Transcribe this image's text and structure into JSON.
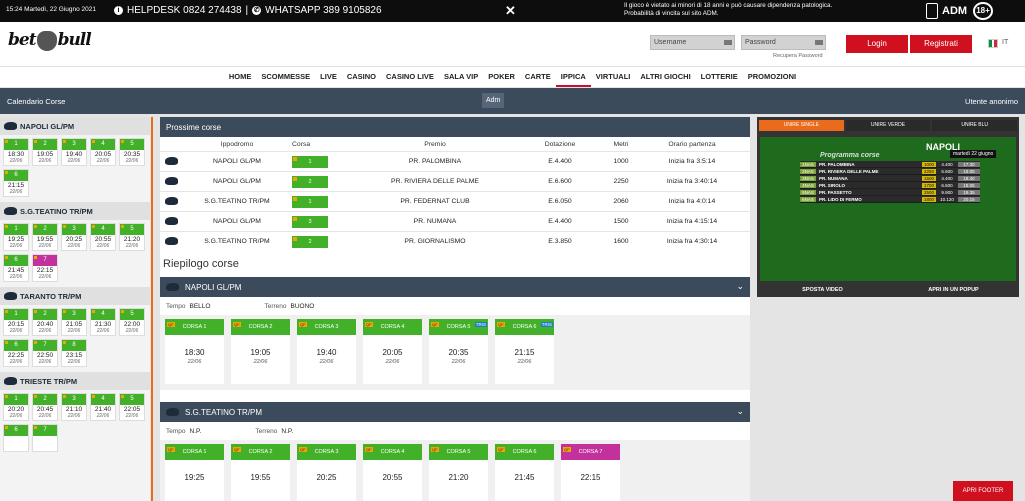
{
  "topbar": {
    "datetime": "15:24 Martedì, 22 Giugno 2021",
    "helpdesk": "HELPDESK 0824 274438",
    "whatsapp": "WHATSAPP 389 9105826",
    "close": "✕",
    "warning1": "Il gioco è vietato ai minori di 18 anni e può causare dipendenza patologica.",
    "warning2": "Probabilità di vincita sul sito ADM.",
    "adm": "ADM",
    "age": "18+"
  },
  "header": {
    "logo_a": "bet",
    "logo_b": "bull",
    "username_placeholder": "Username",
    "password_placeholder": "Password",
    "recover": "Recupera Password",
    "login": "Login",
    "register": "Registrati",
    "lang": "IT"
  },
  "nav": [
    "HOME",
    "SCOMMESSE",
    "LIVE",
    "CASINO",
    "CASINO LIVE",
    "SALA VIP",
    "POKER",
    "CARTE",
    "IPPICA",
    "VIRTUALI",
    "ALTRI GIOCHI",
    "LOTTERIE",
    "PROMOZIONI"
  ],
  "subbar": {
    "left": "Calendario Corse",
    "mid": "Adm",
    "right": "Utente anonimo"
  },
  "sidebar": [
    {
      "name": "NAPOLI GL/PM",
      "cells": [
        {
          "n": "1",
          "t": "18:30",
          "d": "22/06"
        },
        {
          "n": "2",
          "t": "19:05",
          "d": "22/06"
        },
        {
          "n": "3",
          "t": "19:40",
          "d": "22/06"
        },
        {
          "n": "4",
          "t": "20:05",
          "d": "22/06"
        },
        {
          "n": "5",
          "t": "20:35",
          "d": "22/06"
        },
        {
          "n": "6",
          "t": "21:15",
          "d": "22/06"
        }
      ]
    },
    {
      "name": "S.G.TEATINO TR/PM",
      "cells": [
        {
          "n": "1",
          "t": "19:25",
          "d": "22/06"
        },
        {
          "n": "2",
          "t": "19:55",
          "d": "22/06"
        },
        {
          "n": "3",
          "t": "20:25",
          "d": "22/06"
        },
        {
          "n": "4",
          "t": "20:55",
          "d": "22/06"
        },
        {
          "n": "5",
          "t": "21:20",
          "d": "22/06"
        },
        {
          "n": "6",
          "t": "21:45",
          "d": "22/06"
        },
        {
          "n": "7",
          "t": "22:15",
          "d": "22/06",
          "pink": true
        }
      ]
    },
    {
      "name": "TARANTO TR/PM",
      "cells": [
        {
          "n": "1",
          "t": "20:15",
          "d": "22/06"
        },
        {
          "n": "2",
          "t": "20:40",
          "d": "22/06"
        },
        {
          "n": "3",
          "t": "21:05",
          "d": "22/06"
        },
        {
          "n": "4",
          "t": "21:30",
          "d": "22/06"
        },
        {
          "n": "5",
          "t": "22:00",
          "d": "22/06"
        },
        {
          "n": "6",
          "t": "22:25",
          "d": "22/06"
        },
        {
          "n": "7",
          "t": "22:50",
          "d": "22/06"
        },
        {
          "n": "8",
          "t": "23:15",
          "d": "22/06"
        }
      ]
    },
    {
      "name": "TRIESTE TR/PM",
      "cells": [
        {
          "n": "1",
          "t": "20:20",
          "d": "22/06"
        },
        {
          "n": "2",
          "t": "20:45",
          "d": "22/06"
        },
        {
          "n": "3",
          "t": "21:10",
          "d": "22/06"
        },
        {
          "n": "4",
          "t": "21:40",
          "d": "22/06"
        },
        {
          "n": "5",
          "t": "22:05",
          "d": "22/06"
        },
        {
          "n": "6",
          "t": "",
          "d": ""
        },
        {
          "n": "7",
          "t": "",
          "d": ""
        }
      ]
    }
  ],
  "prossime": {
    "title": "Prossime corse",
    "headers": [
      "Ippodromo",
      "Corsa",
      "Premio",
      "Dotazione",
      "Metri",
      "Orario partenza"
    ],
    "rows": [
      [
        "NAPOLI GL/PM",
        "1",
        "PR. PALOMBINA",
        "E.4.400",
        "1000",
        "Inizia fra 3:5:14"
      ],
      [
        "NAPOLI GL/PM",
        "2",
        "PR. RIVIERA DELLE PALME",
        "E.6.600",
        "2250",
        "Inizia fra 3:40:14"
      ],
      [
        "S.G.TEATINO TR/PM",
        "1",
        "PR. FEDERNAT CLUB",
        "E.6.050",
        "2060",
        "Inizia fra 4:0:14"
      ],
      [
        "NAPOLI GL/PM",
        "3",
        "PR. NUMANA",
        "E.4.400",
        "1500",
        "Inizia fra 4:15:14"
      ],
      [
        "S.G.TEATINO TR/PM",
        "2",
        "PR. GIORNALISMO",
        "E.3.850",
        "1600",
        "Inizia fra 4:30:14"
      ]
    ]
  },
  "riepilogo": {
    "title": "Riepilogo corse",
    "blocks": [
      {
        "name": "NAPOLI GL/PM",
        "tempo_label": "Tempo",
        "tempo": "BELLO",
        "terreno_label": "Terreno",
        "terreno": "BUONO",
        "cards": [
          {
            "l": "CORSA 1",
            "t": "18:30",
            "d": "22/06"
          },
          {
            "l": "CORSA 2",
            "t": "19:05",
            "d": "22/06"
          },
          {
            "l": "CORSA 3",
            "t": "19:40",
            "d": "22/06"
          },
          {
            "l": "CORSA 4",
            "t": "20:05",
            "d": "22/06"
          },
          {
            "l": "CORSA 5",
            "t": "20:35",
            "d": "22/06",
            "tris": "TRIS"
          },
          {
            "l": "CORSA 6",
            "t": "21:15",
            "d": "22/06",
            "tris": "TRIS"
          }
        ]
      },
      {
        "name": "S.G.TEATINO TR/PM",
        "tempo_label": "Tempo",
        "tempo": "N.P.",
        "terreno_label": "Terreno",
        "terreno": "N.P.",
        "cards": [
          {
            "l": "CORSA 1",
            "t": "19:25",
            "d": ""
          },
          {
            "l": "CORSA 2",
            "t": "19:55",
            "d": ""
          },
          {
            "l": "CORSA 3",
            "t": "20:25",
            "d": ""
          },
          {
            "l": "CORSA 4",
            "t": "20:55",
            "d": ""
          },
          {
            "l": "CORSA 5",
            "t": "21:20",
            "d": ""
          },
          {
            "l": "CORSA 6",
            "t": "21:45",
            "d": ""
          },
          {
            "l": "CORSA 7",
            "t": "22:15",
            "d": "",
            "pink": true
          }
        ]
      }
    ]
  },
  "video": {
    "tabs": [
      "UNIRE SINGLE",
      "UNIRE VERDE",
      "UNIRE BLU"
    ],
    "title": "NAPOLI",
    "subtitle": "Programma corse",
    "date": "martedì 22 giugno",
    "rows": [
      [
        "1NAS",
        "PR. PALOMBINA",
        "1000",
        "4.400",
        "17.30"
      ],
      [
        "2NAS",
        "PR. RIVIERA DELLE PALME",
        "2250",
        "6.600",
        "18.05"
      ],
      [
        "3NAS",
        "PR. NUMANA",
        "1500",
        "4.400",
        "18.40"
      ],
      [
        "4NAS",
        "PR. SIROLO",
        "1700",
        "6.600",
        "19.05"
      ],
      [
        "5NAS",
        "PR. PASSETTO",
        "2500",
        "9.900",
        "19.35"
      ],
      [
        "6NAS",
        "PR. LIDO DI FERMO",
        "1800",
        "10.120",
        "20.15"
      ]
    ],
    "bottom": [
      "SPOSTA VIDEO",
      "APRI IN UN POPUP"
    ]
  },
  "footer_btn": "APRI FOOTER"
}
